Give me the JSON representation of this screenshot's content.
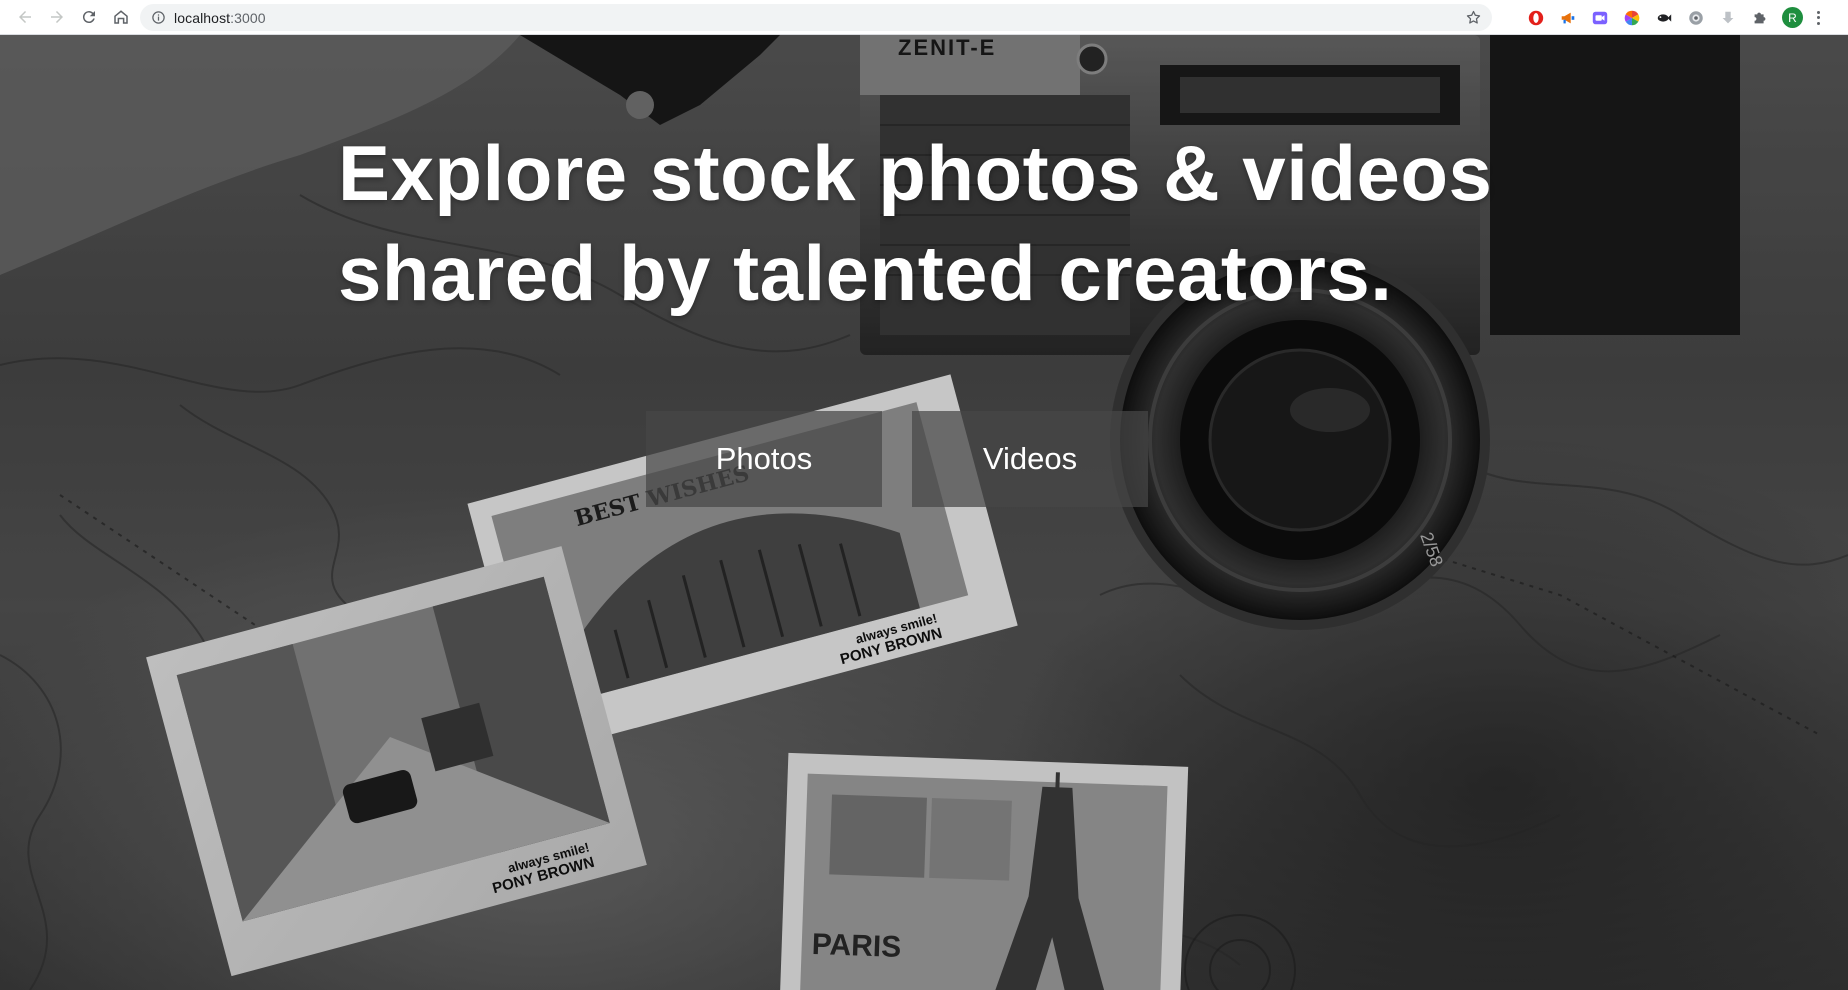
{
  "browser": {
    "url_host": "localhost",
    "url_port": ":3000",
    "profile_initial": "R",
    "extensions": [
      "opera-icon",
      "megaphone-icon",
      "meet-icon",
      "color-wheel-icon",
      "fish-icon",
      "gear-globe-icon",
      "download-arrow-icon",
      "puzzle-icon"
    ]
  },
  "hero": {
    "headline_line1": "Explore stock photos & videos",
    "headline_line2": "shared by talented creators.",
    "buttons": [
      {
        "label": "Photos"
      },
      {
        "label": "Videos"
      }
    ],
    "photo_texts": {
      "camera_brand": "ZENIT-E",
      "lens_marking": "2/58",
      "postcard_best_wishes": "BEST WISHES",
      "postcard_slogan_1": "always smile!",
      "postcard_author_1": "PONY BROWN",
      "postcard_slogan_2": "always smile!",
      "postcard_author_2": "PONY BROWN",
      "postcard_paris": "PARIS"
    }
  }
}
